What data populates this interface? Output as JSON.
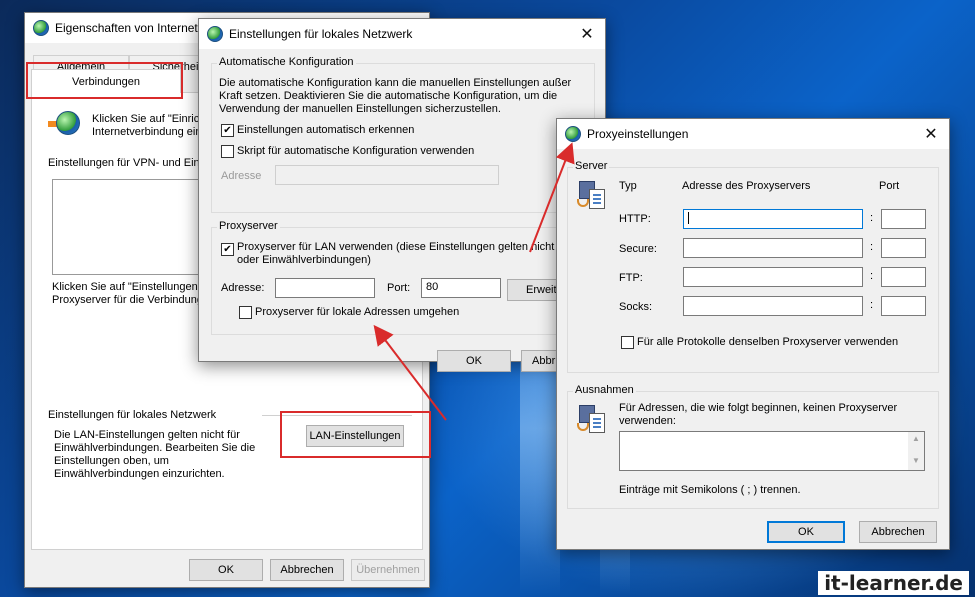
{
  "internet_window": {
    "title": "Eigenschaften von Internet",
    "tabs": [
      "Allgemein",
      "Sicherheit",
      "Verbindungen"
    ],
    "dialup_text_1": "Klicken Sie auf \"Einrichten\"",
    "dialup_text_2": "Internetverbindung einzu",
    "vpn_label": "Einstellungen für VPN- und Einw",
    "proxy_text_1": "Klicken Sie auf \"Einstellungen\",",
    "proxy_text_2": "Proxyserver für die Verbindung",
    "lan_group_label": "Einstellungen für lokales Netzwerk",
    "lan_description": "Die LAN-Einstellungen gelten nicht für Einwählverbindungen. Bearbeiten Sie die Einstellungen oben, um Einwählverbindungen einzurichten.",
    "lan_button": "LAN-Einstellungen",
    "ok": "OK",
    "cancel": "Abbrechen",
    "apply": "Übernehmen"
  },
  "lan_window": {
    "title": "Einstellungen für lokales Netzwerk",
    "auto_group": "Automatische Konfiguration",
    "auto_description": "Die automatische Konfiguration kann die manuellen Einstellungen außer Kraft setzen. Deaktivieren Sie die automatische Konfiguration, um die Verwendung der manuellen Einstellungen sicherzustellen.",
    "auto_detect_label": "Einstellungen automatisch erkennen",
    "auto_detect_checked": true,
    "script_label": "Skript für automatische Konfiguration verwenden",
    "script_checked": false,
    "address_label": "Adresse",
    "proxy_group": "Proxyserver",
    "use_proxy_label": "Proxyserver für LAN verwenden (diese Einstellungen gelten nicht f VPN- oder Einwählverbindungen)",
    "use_proxy_checked": true,
    "proxy_address_label": "Adresse:",
    "proxy_address_value": "",
    "port_label": "Port:",
    "port_value": "80",
    "advanced_button": "Erweit",
    "bypass_label": "Proxyserver für lokale Adressen umgehen",
    "bypass_checked": false,
    "ok": "OK",
    "cancel": "Abbr"
  },
  "proxy_window": {
    "title": "Proxyeinstellungen",
    "server_group": "Server",
    "col_type": "Typ",
    "col_address": "Adresse des Proxyservers",
    "col_port": "Port",
    "rows": [
      {
        "type": "HTTP:",
        "address": "",
        "port": ""
      },
      {
        "type": "Secure:",
        "address": "",
        "port": ""
      },
      {
        "type": "FTP:",
        "address": "",
        "port": ""
      },
      {
        "type": "Socks:",
        "address": "",
        "port": ""
      }
    ],
    "colon": ":",
    "same_proxy_label": "Für alle Protokolle denselben Proxyserver verwenden",
    "same_proxy_checked": false,
    "exceptions_group": "Ausnahmen",
    "exceptions_text": "Für Adressen, die wie folgt beginnen, keinen Proxyserver verwenden:",
    "exceptions_value": "",
    "semicolon_hint": "Einträge mit Semikolons ( ; ) trennen.",
    "ok": "OK",
    "cancel": "Abbrechen"
  },
  "watermark": "it-learner.de",
  "colors": {
    "highlight_red": "#d92b2b",
    "accent_blue": "#0078d7"
  }
}
